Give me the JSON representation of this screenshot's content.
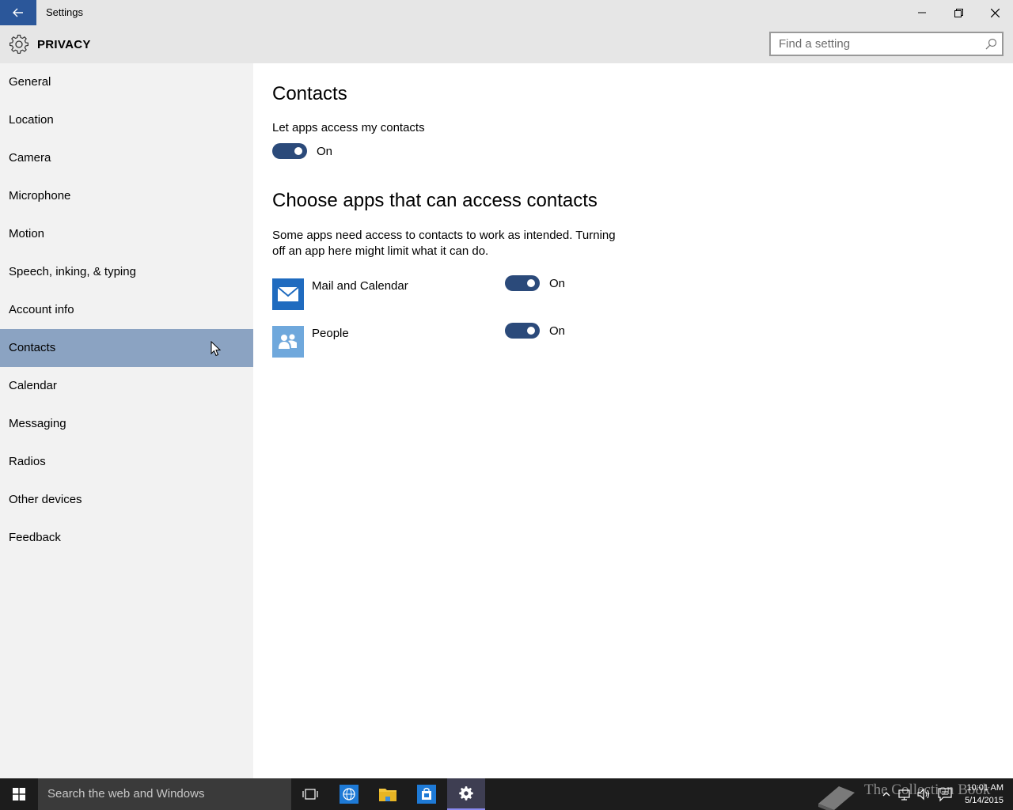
{
  "window": {
    "title": "Settings"
  },
  "header": {
    "title": "PRIVACY",
    "search_placeholder": "Find a setting"
  },
  "sidebar": {
    "items": [
      {
        "label": "General"
      },
      {
        "label": "Location"
      },
      {
        "label": "Camera"
      },
      {
        "label": "Microphone"
      },
      {
        "label": "Motion"
      },
      {
        "label": "Speech, inking, & typing"
      },
      {
        "label": "Account info"
      },
      {
        "label": "Contacts",
        "selected": true
      },
      {
        "label": "Calendar"
      },
      {
        "label": "Messaging"
      },
      {
        "label": "Radios"
      },
      {
        "label": "Other devices"
      },
      {
        "label": "Feedback"
      }
    ]
  },
  "main": {
    "heading": "Contacts",
    "master_toggle": {
      "label": "Let apps access my contacts",
      "state": "On"
    },
    "apps_heading": "Choose apps that can access contacts",
    "description": "Some apps need access to contacts to work as intended. Turning off an app here might limit what it can do.",
    "apps": [
      {
        "name": "Mail and Calendar",
        "state": "On",
        "icon": "mail-icon"
      },
      {
        "name": "People",
        "state": "On",
        "icon": "people-icon"
      }
    ]
  },
  "taskbar": {
    "search_placeholder": "Search the web and Windows",
    "watermark": "The Collection Book",
    "time": "10:01 AM",
    "date": "5/14/2015"
  },
  "colors": {
    "accent": "#2b579a",
    "selected_nav": "#8ba3c2",
    "toggle_on": "#2b4a7a"
  }
}
